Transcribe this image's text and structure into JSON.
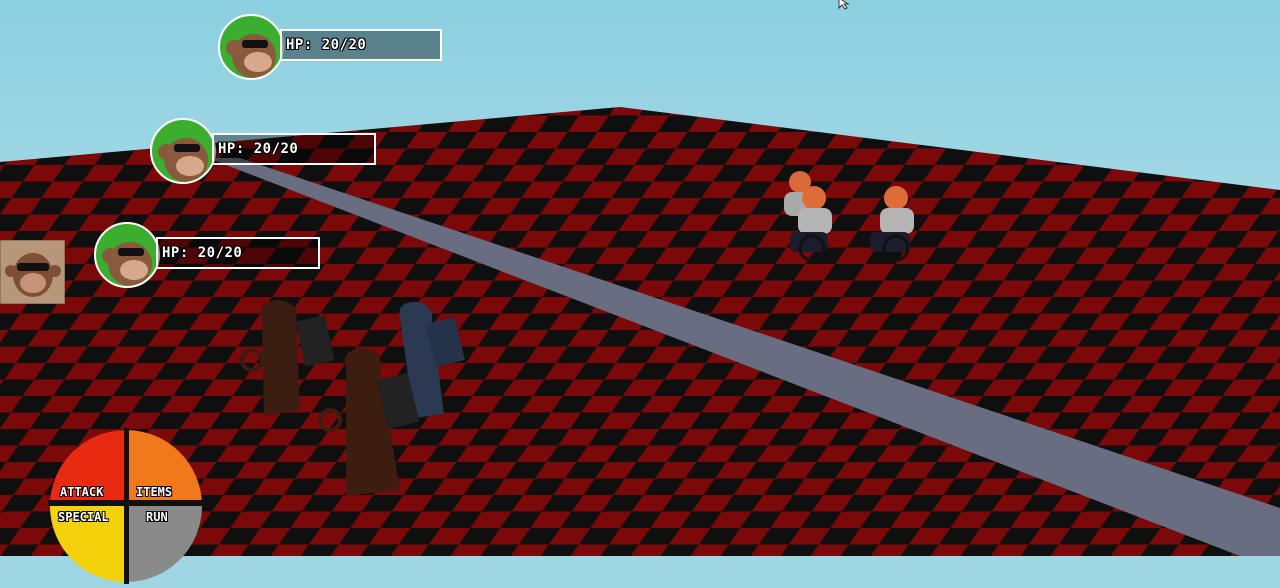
{
  "party": [
    {
      "hp_label": "HP: 20/20",
      "portrait_icon": "monkey-sunglasses-icon"
    },
    {
      "hp_label": "HP: 20/20",
      "portrait_icon": "monkey-sunglasses-icon"
    },
    {
      "hp_label": "HP: 20/20",
      "portrait_icon": "monkey-sunglasses-icon"
    }
  ],
  "active_turn": {
    "portrait_icon": "monkey-sunglasses-icon"
  },
  "commands": {
    "attack": "ATTACK",
    "items": "ITEMS",
    "special": "SPECIAL",
    "run": "RUN"
  },
  "colors": {
    "sky": "#9fd6e3",
    "floor_red": "#8e0b0b",
    "floor_black": "#111111",
    "portrait_bg": "#3cae2f",
    "attack": "#e82a10",
    "items": "#f07a1a",
    "special": "#f3d20c",
    "run": "#8a8a8a"
  }
}
